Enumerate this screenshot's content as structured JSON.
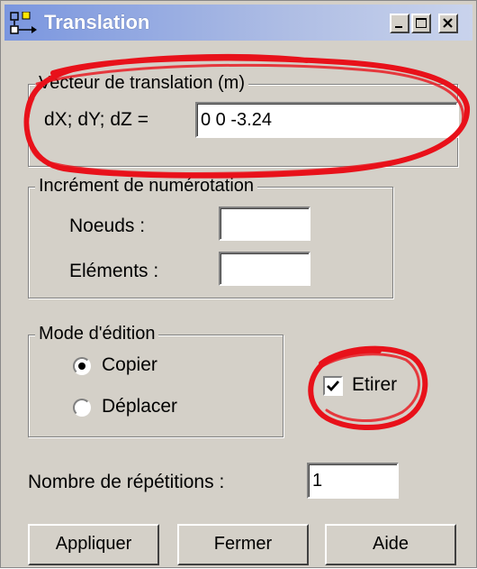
{
  "window": {
    "title": "Translation",
    "controls": {
      "minimize": "minimize",
      "maximize": "maximize",
      "close": "close"
    }
  },
  "translation_vector": {
    "group_label": "Vecteur de translation (m)",
    "field_label": "dX; dY; dZ  =",
    "value": "0 0 -3.24"
  },
  "numbering": {
    "group_label": "Incrément de numérotation",
    "nodes_label": "Noeuds :",
    "nodes_value": "",
    "elements_label": "Eléments :",
    "elements_value": ""
  },
  "edit_mode": {
    "group_label": "Mode d'édition",
    "copy_label": "Copier",
    "move_label": "Déplacer",
    "selected": "Copier"
  },
  "stretch": {
    "label": "Etirer",
    "checked": true
  },
  "repetitions": {
    "label": "Nombre de répétitions :",
    "value": "1"
  },
  "buttons": {
    "apply": "Appliquer",
    "close": "Fermer",
    "help": "Aide"
  },
  "colors": {
    "annotation": "#e8111a",
    "titlebar": "#7a96df",
    "face": "#d4d0c8"
  }
}
